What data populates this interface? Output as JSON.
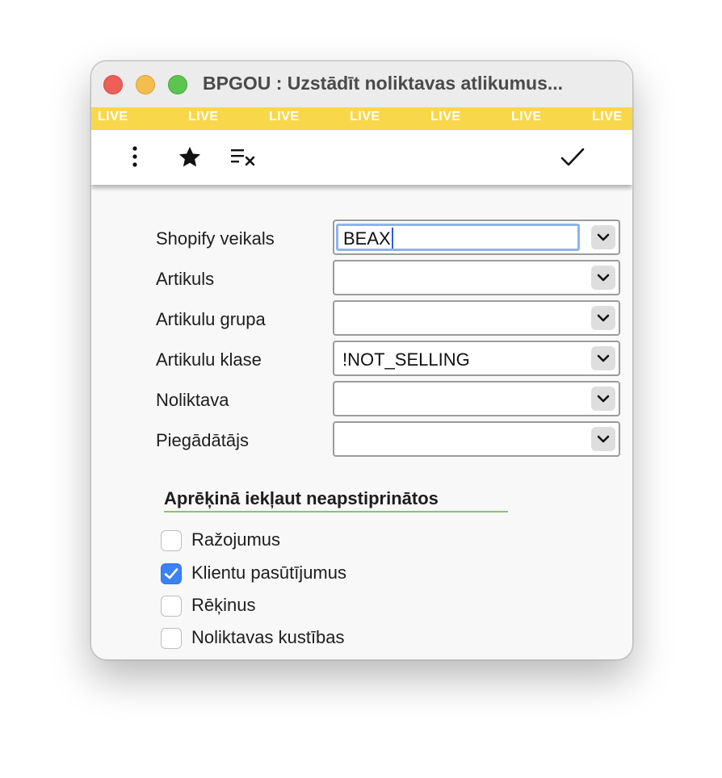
{
  "window": {
    "title": "BPGOU : Uzstādīt noliktavas atlikumus..."
  },
  "live_bar": {
    "items": [
      "LIVE",
      "LIVE",
      "LIVE",
      "LIVE",
      "LIVE",
      "LIVE",
      "LIVE"
    ],
    "color": "#f9d74b"
  },
  "toolbar": {
    "icons": [
      "more-vertical-icon",
      "star-icon",
      "clear-filter-icon",
      "checkmark-icon"
    ]
  },
  "form": {
    "fields": [
      {
        "label": "Shopify veikals",
        "value": "BEAX"
      },
      {
        "label": "Artikuls",
        "value": ""
      },
      {
        "label": "Artikulu grupa",
        "value": ""
      },
      {
        "label": "Artikulu klase",
        "value": "!NOT_SELLING"
      },
      {
        "label": "Noliktava",
        "value": ""
      },
      {
        "label": "Piegādātājs",
        "value": ""
      }
    ]
  },
  "section": {
    "title": "Aprēķinā iekļaut neapstiprinātos",
    "options": [
      {
        "label": "Ražojumus",
        "checked": false
      },
      {
        "label": "Klientu pasūtījumus",
        "checked": true
      },
      {
        "label": "Rēķinus",
        "checked": false
      },
      {
        "label": "Noliktavas kustības",
        "checked": false
      }
    ]
  },
  "colors": {
    "accent": "#3a82f6",
    "focus_ring": "#8cb3f0",
    "section_underline": "#8fc26e"
  }
}
